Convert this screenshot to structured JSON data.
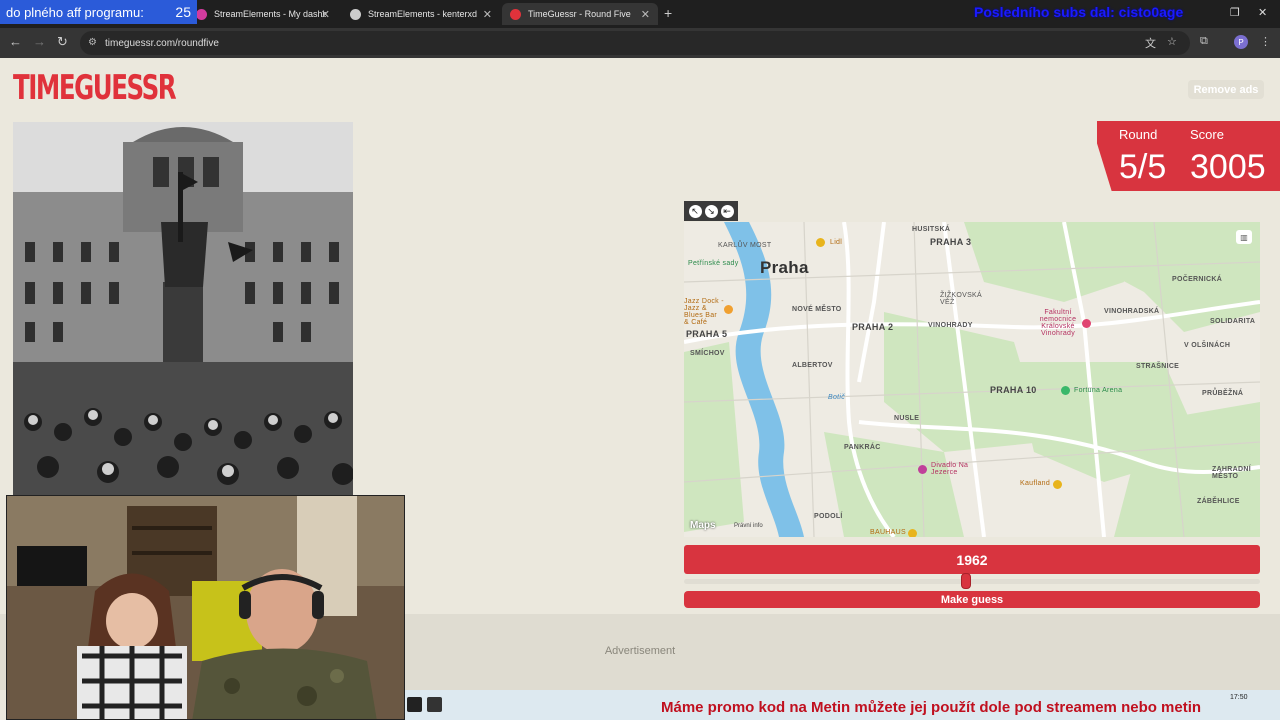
{
  "browser": {
    "overlay_aff_text": "do plného aff programu:",
    "overlay_aff_count": "25",
    "tabs": [
      {
        "title": "StreamElements - My dashboard",
        "color": "#d23b9e"
      },
      {
        "title": "StreamElements - kenterxd",
        "color": "#cccccc"
      },
      {
        "title": "TimeGuessr - Round Five",
        "color": "#e0323b"
      }
    ],
    "top_overlay_text": "Posledního subs dal: cisto0age",
    "url": "timeguessr.com/roundfive",
    "profile_initial": "P"
  },
  "page": {
    "logo": "TIMEGUESSR",
    "remove_ads": "Remove ads",
    "round_label": "Round",
    "score_label": "Score",
    "round_value": "5/5",
    "score_value": "3005",
    "year_value": "1962",
    "make_guess": "Make guess",
    "advertisement": "Advertisement",
    "slider_fraction": 0.49
  },
  "map": {
    "city": "Praha",
    "labels": {
      "praha3": "PRAHA 3",
      "praha2": "PRAHA 2",
      "praha5": "PRAHA 5",
      "praha10": "PRAHA 10",
      "nove_mesto": "NOVÉ MĚSTO",
      "vinohrady": "VINOHRADY",
      "vinohradska": "VINOHRADSKÁ",
      "albertov": "ALBERTOV",
      "smichov": "SMÍCHOV",
      "nusle": "NUSLE",
      "pankrac": "PANKRÁC",
      "podoli": "PODOLÍ",
      "strasnice": "STRAŠNICE",
      "solidarita": "SOLIDARITA",
      "zahradni": "ZAHRADNÍ MĚSTO",
      "zabehlice": "ZÁBĚHLICE",
      "pocernicka": "POČERNICKÁ",
      "olsinach": "V OLŠINÁCH",
      "pruzna": "PRŮBĚŽNÁ",
      "husitska": "HUSITSKÁ",
      "zizkov": "ŽIŽKOVSKÁ VĚŽ",
      "karluv": "KARLŮV MOST",
      "petrin": "Petřínské sady",
      "lidl": "Lidl",
      "jazz": "Jazz Dock - Jazz & Blues Bar & Café",
      "fakultni": "Fakultní nemocnice Královské Vinohrady",
      "fortuna": "Fortuna Arena",
      "divadlo": "Divadlo Na Jezerce",
      "kaufland": "Kaufland",
      "bauhaus": "BAUHAUS",
      "botic": "Botič",
      "apple_maps": "Maps",
      "legal": "Právní info"
    }
  },
  "stream": {
    "ticker": "Máme promo kod na Metin můžete jej použít dole pod streamem nebo metin",
    "clock": "17:50"
  }
}
